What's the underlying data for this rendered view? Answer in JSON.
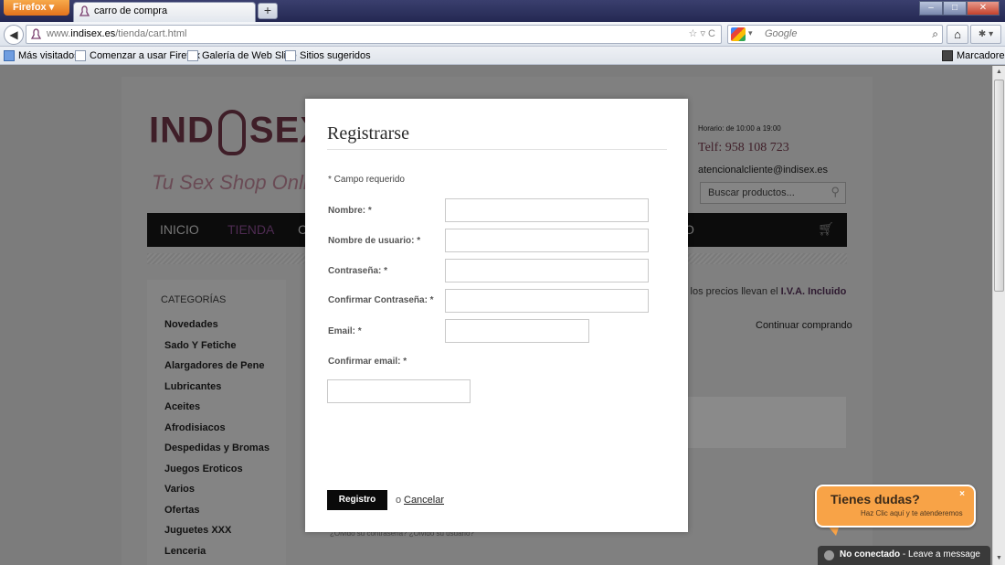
{
  "browser": {
    "menu_label": "Firefox",
    "tab_title": "carro de compra",
    "new_tab": "+",
    "url_prefix": "www.",
    "url_domain": "indisex.es",
    "url_path": "/tienda/cart.html",
    "search_placeholder": "Google",
    "bookmarks_menu": "Marcadores",
    "bookmarks": [
      "Más visitados",
      "Comenzar a usar Firefox",
      "Galería de Web Slice",
      "Sitios sugeridos"
    ]
  },
  "site": {
    "logo_left": "IND",
    "logo_right": "SEX",
    "tagline": "Tu Sex Shop Onli",
    "hours": "Horario: de 10:00 a 19:00",
    "phone": "Telf: 958 108 723",
    "email": "atencionalcliente@indisex.es",
    "search_placeholder": "Buscar productos...",
    "menu": [
      "INICIO",
      "TIENDA",
      "C",
      "O"
    ],
    "categories_title": "CATEGORÍAS",
    "categories": [
      "Novedades",
      "Sado Y Fetiche",
      "Alargadores de Pene",
      "Lubricantes",
      "Aceites",
      "Afrodisiacos",
      "Despedidas y Bromas",
      "Juegos Eroticos",
      "Varios",
      "Ofertas",
      "Juguetes XXX",
      "Lenceria"
    ],
    "iva_text": "s los precios llevan el ",
    "iva_bold": "I.V.A. Incluido",
    "continue_shopping": "Continuar comprando",
    "forgot_text": "¿Olvidó su contraseña?   ¿Olvidó su usuario?"
  },
  "modal": {
    "title": "Registrarse",
    "required_note": "* Campo requerido",
    "fields": {
      "name": "Nombre: *",
      "username": "Nombre de usuario: *",
      "password": "Contraseña: *",
      "confirm_password": "Confirmar Contraseña: *",
      "email": "Email: *",
      "confirm_email": "Confirmar email: *"
    },
    "values": {
      "name": "",
      "username": "",
      "password": "",
      "confirm_password": "",
      "email": "",
      "confirm_email": ""
    },
    "submit_label": "Registro",
    "or_text": "o",
    "cancel_label": "Cancelar"
  },
  "chat": {
    "title": "Tienes dudas?",
    "subtitle": "Haz Clic aquí y te atenderemos",
    "close": "×",
    "status_bold": "No conectado",
    "status_rest": " - Leave a message"
  },
  "colors": {
    "accent_purple": "#4e2b52",
    "chat_orange": "#f8a347",
    "modal_button": "#0a0a0a"
  }
}
